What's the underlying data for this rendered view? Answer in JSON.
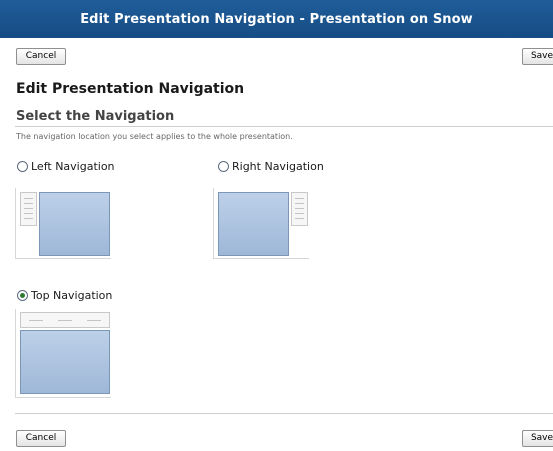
{
  "window": {
    "title": "Edit Presentation Navigation - Presentation on Snow"
  },
  "toolbar": {
    "cancel_label": "Cancel",
    "save_label": "Save"
  },
  "page": {
    "heading": "Edit Presentation Navigation",
    "section_title": "Select the Navigation",
    "hint": "The navigation location you select applies to the whole presentation."
  },
  "options": [
    {
      "label": "Left Navigation",
      "selected": false
    },
    {
      "label": "Right Navigation",
      "selected": false
    },
    {
      "label": "Top Navigation",
      "selected": true
    }
  ],
  "colors": {
    "title_bar": "#1f5d9a",
    "preview_pane": "#aac0de",
    "selected_radio": "#2c7a34"
  }
}
